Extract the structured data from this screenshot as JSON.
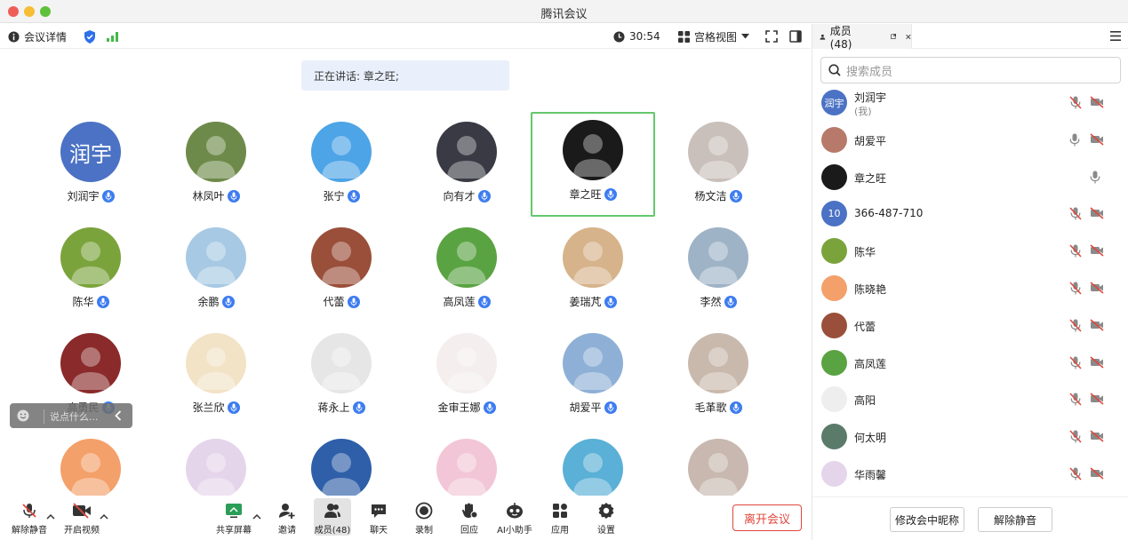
{
  "window": {
    "title": "腾讯会议"
  },
  "toolbar": {
    "meeting_details": "会议详情",
    "duration": "30:54",
    "view_mode": "宫格视图"
  },
  "speaking": "正在讲话: 章之旺;",
  "grid": [
    {
      "name": "刘润宇",
      "avatar_text": "润宇",
      "avatar_color": "#4b72c4"
    },
    {
      "name": "林凤叶",
      "avatar_color": "#6e8a4a"
    },
    {
      "name": "张宁",
      "avatar_color": "#4da4e6"
    },
    {
      "name": "向有才",
      "avatar_color": "#3a3a44"
    },
    {
      "name": "章之旺",
      "avatar_color": "#1a1a1a",
      "active": true
    },
    {
      "name": "杨文洁",
      "avatar_color": "#c9c0bb"
    },
    {
      "name": "陈华",
      "avatar_color": "#7ba33c"
    },
    {
      "name": "余鹏",
      "avatar_color": "#a7c9e4"
    },
    {
      "name": "代蕾",
      "avatar_color": "#9a4f3a"
    },
    {
      "name": "高凤莲",
      "avatar_color": "#5aa342"
    },
    {
      "name": "姜瑞芃",
      "avatar_color": "#d6b38a"
    },
    {
      "name": "李然",
      "avatar_color": "#9fb3c6"
    },
    {
      "name": "高勇民",
      "avatar_color": "#8a2a2a"
    },
    {
      "name": "张兰欣",
      "avatar_color": "#f2e2c6"
    },
    {
      "name": "蒋永上",
      "avatar_color": "#e6e6e6"
    },
    {
      "name": "金审王娜",
      "avatar_color": "#f4eeee"
    },
    {
      "name": "胡爱平",
      "avatar_color": "#8fb0d6"
    },
    {
      "name": "毛革歌",
      "avatar_color": "#c9b9ad"
    },
    {
      "name": "",
      "avatar_color": "#f4a06a"
    },
    {
      "name": "",
      "avatar_color": "#e5d5ea"
    },
    {
      "name": "",
      "avatar_color": "#2e5fa8"
    },
    {
      "name": "",
      "avatar_color": "#f2c6d6"
    },
    {
      "name": "",
      "avatar_color": "#5ab0d6"
    },
    {
      "name": "",
      "avatar_color": "#c8b8b0"
    }
  ],
  "chat_float": {
    "placeholder": "说点什么..."
  },
  "bottombar": {
    "unmute": "解除静音",
    "start_video": "开启视频",
    "share_screen": "共享屏幕",
    "invite": "邀请",
    "members": "成员(48)",
    "chat": "聊天",
    "record": "录制",
    "replay": "回应",
    "ai_assistant": "AI小助手",
    "apps": "应用",
    "settings": "设置",
    "leave": "离开会议"
  },
  "sidebar": {
    "tab": "成员(48)",
    "search_placeholder": "搜索成员",
    "members": [
      {
        "name": "刘润宇",
        "sub": "(我)",
        "avatar_text": "润宇",
        "avatar_color": "#4b72c4",
        "mic": "muted",
        "cam": "off"
      },
      {
        "name": "胡爱平",
        "avatar_color": "#b77a6a",
        "mic": "on",
        "cam": "off"
      },
      {
        "name": "章之旺",
        "avatar_color": "#1a1a1a",
        "mic": "on",
        "cam": ""
      },
      {
        "name": "366-487-710",
        "avatar_text": "10",
        "avatar_color": "#4b72c4",
        "mic": "muted",
        "cam": "off"
      },
      {
        "name": "陈华",
        "avatar_color": "#7ba33c",
        "mic": "muted",
        "cam": "off"
      },
      {
        "name": "陈晓艳",
        "avatar_color": "#f4a06a",
        "mic": "muted",
        "cam": "off"
      },
      {
        "name": "代蕾",
        "avatar_color": "#9a4f3a",
        "mic": "muted",
        "cam": "off"
      },
      {
        "name": "高凤莲",
        "avatar_color": "#5aa342",
        "mic": "muted",
        "cam": "off"
      },
      {
        "name": "高阳",
        "avatar_color": "#eeeeee",
        "mic": "muted",
        "cam": "off"
      },
      {
        "name": "何太明",
        "avatar_color": "#5a7a6a",
        "mic": "muted",
        "cam": "off"
      },
      {
        "name": "华雨馨",
        "avatar_color": "#e5d5ea",
        "mic": "muted",
        "cam": "off"
      }
    ],
    "rename_button": "修改会中昵称",
    "unmute_button": "解除静音"
  }
}
